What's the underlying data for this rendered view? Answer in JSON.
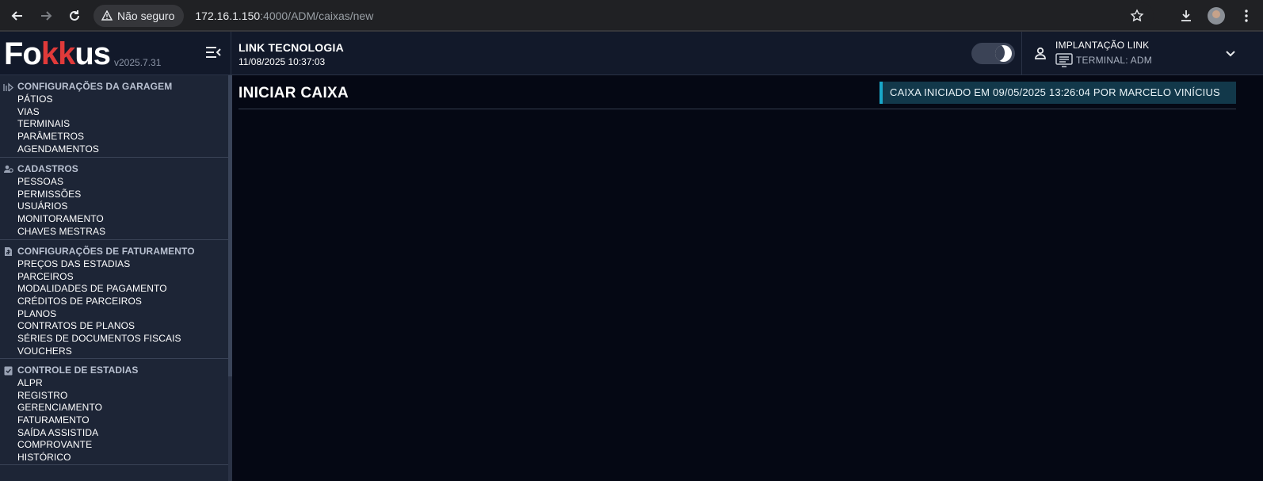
{
  "browser": {
    "security_label": "Não seguro",
    "url_host": "172.16.1.150",
    "url_rest": ":4000/ADM/caixas/new"
  },
  "header": {
    "logo_part1": "Fo",
    "logo_part2": "kk",
    "logo_part3": "us",
    "version": "v2025.7.31",
    "company_name": "LINK TECNOLOGIA",
    "datetime": "11/08/2025 10:37:03",
    "user_name": "IMPLANTAÇÃO LINK",
    "terminal": "TERMINAL: ADM"
  },
  "sidebar": {
    "sections": [
      {
        "title": "CONFIGURAÇÕES DA GARAGEM",
        "icon": "garage-icon",
        "items": [
          "PÁTIOS",
          "VIAS",
          "TERMINAIS",
          "PARÂMETROS",
          "AGENDAMENTOS"
        ]
      },
      {
        "title": "CADASTROS",
        "icon": "users-icon",
        "items": [
          "PESSOAS",
          "PERMISSÕES",
          "USUÁRIOS",
          "MONITORAMENTO",
          "CHAVES MESTRAS"
        ]
      },
      {
        "title": "CONFIGURAÇÕES DE FATURAMENTO",
        "icon": "invoice-icon",
        "items": [
          "PREÇOS DAS ESTADIAS",
          "PARCEIROS",
          "MODALIDADES DE PAGAMENTO",
          "CRÉDITOS DE PARCEIROS",
          "PLANOS",
          "CONTRATOS DE PLANOS",
          "SÉRIES DE DOCUMENTOS FISCAIS",
          "VOUCHERS"
        ]
      },
      {
        "title": "CONTROLE DE ESTADIAS",
        "icon": "clipboard-check-icon",
        "items": [
          "ALPR",
          "REGISTRO",
          "GERENCIAMENTO",
          "FATURAMENTO",
          "SAÍDA ASSISTIDA",
          "COMPROVANTE",
          "HISTÓRICO"
        ]
      }
    ]
  },
  "main": {
    "title": "INICIAR CAIXA",
    "status_banner": "CAIXA INICIADO EM 09/05/2025 13:26:04 POR MARCELO VINÍCIUS"
  },
  "colors": {
    "accent": "#19a7c9",
    "logo_red": "#e03a3a",
    "sidebar_bg": "#1d2536",
    "main_bg": "#050814"
  }
}
